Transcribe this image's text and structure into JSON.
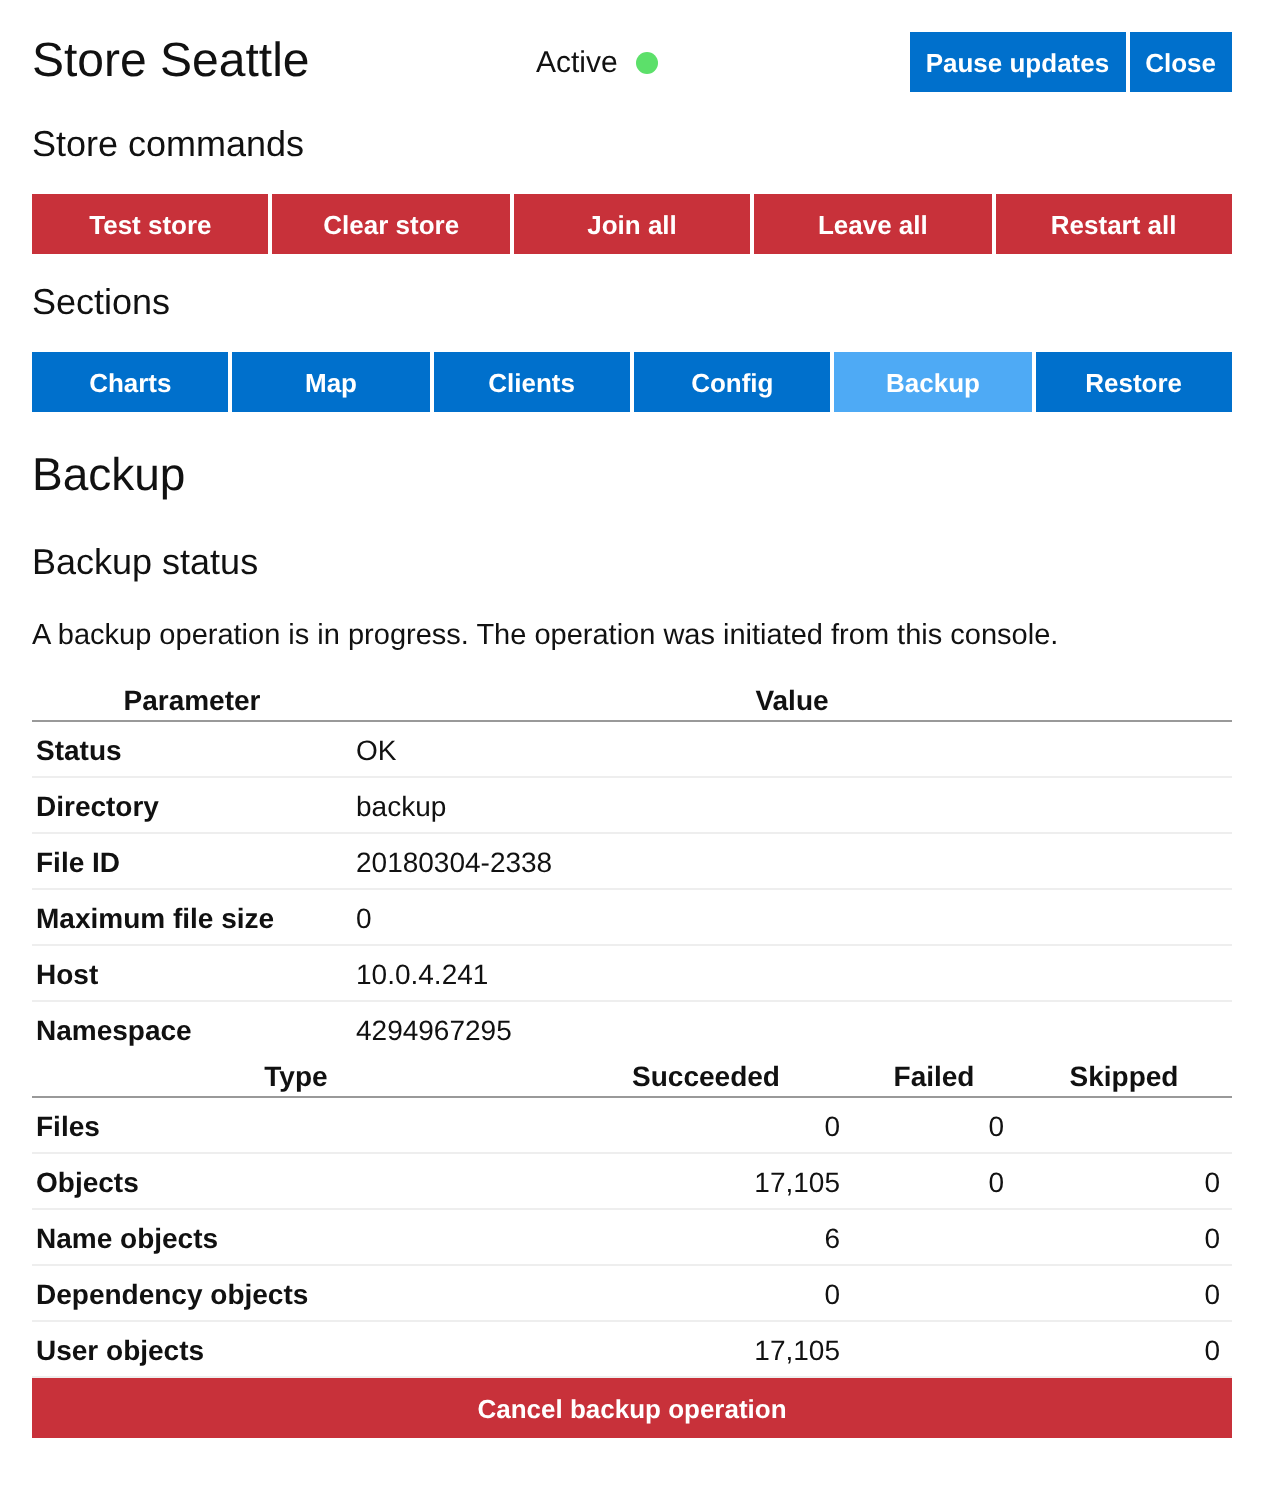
{
  "header": {
    "title": "Store Seattle",
    "status": {
      "label": "Active",
      "active": true
    },
    "buttons": [
      "Pause updates",
      "Close"
    ]
  },
  "commands": {
    "title": "Store commands",
    "buttons": [
      "Test store",
      "Clear store",
      "Join all",
      "Leave all",
      "Restart all"
    ]
  },
  "sections": {
    "title": "Sections",
    "tabs": [
      {
        "label": "Charts",
        "selected": false
      },
      {
        "label": "Map",
        "selected": false
      },
      {
        "label": "Clients",
        "selected": false
      },
      {
        "label": "Config",
        "selected": false
      },
      {
        "label": "Backup",
        "selected": true
      },
      {
        "label": "Restore",
        "selected": false
      }
    ]
  },
  "page": {
    "title": "Backup",
    "subtitle": "Backup status",
    "message": "A backup operation is in progress. The operation was initiated from this console."
  },
  "parameters": {
    "columns": [
      "Parameter",
      "Value"
    ],
    "rows": [
      [
        "Status",
        "OK"
      ],
      [
        "Directory",
        "backup"
      ],
      [
        "File ID",
        "20180304-2338"
      ],
      [
        "Maximum file size",
        "0"
      ],
      [
        "Host",
        "10.0.4.241"
      ],
      [
        "Namespace",
        "4294967295"
      ]
    ]
  },
  "counts": {
    "columns": [
      "Type",
      "Succeeded",
      "Failed",
      "Skipped"
    ],
    "rows": [
      [
        "Files",
        "0",
        "0",
        ""
      ],
      [
        "Objects",
        "17,105",
        "0",
        "0"
      ],
      [
        "Name objects",
        "6",
        "",
        "0"
      ],
      [
        "Dependency objects",
        "0",
        "",
        "0"
      ],
      [
        "User objects",
        "17,105",
        "",
        "0"
      ]
    ]
  },
  "cancel_button": "Cancel backup operation"
}
